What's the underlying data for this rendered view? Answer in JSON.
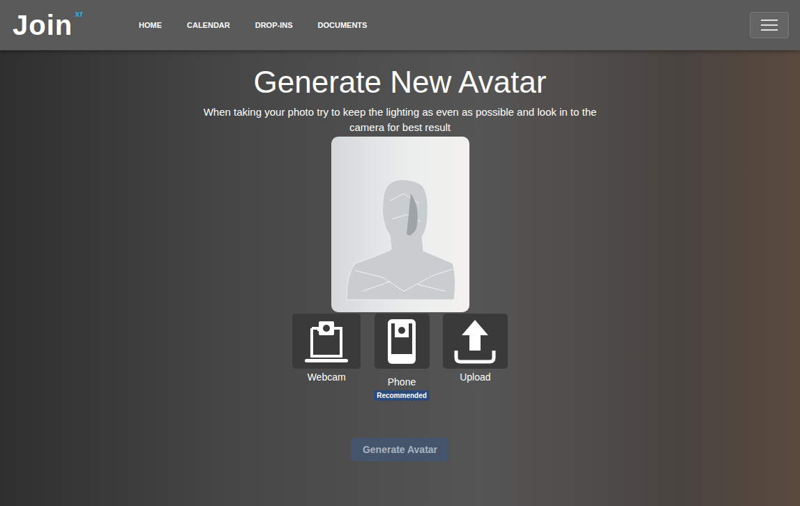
{
  "navbar": {
    "logo": {
      "text": "Join",
      "superscript": "xr"
    },
    "items": [
      {
        "label": "HOME",
        "selected": false
      },
      {
        "label": "CALENDAR",
        "selected": false
      },
      {
        "label": "DROP-INS",
        "selected": false
      },
      {
        "label": "DOCUMENTS",
        "selected": false
      }
    ]
  },
  "title": "Generate New Avatar",
  "subtitle": "When taking your photo try to keep the lighting as even as possible and look in to the camera for best result",
  "options": [
    {
      "label": "Webcam",
      "kind": "webcam",
      "recommended": false,
      "badge": ""
    },
    {
      "label": "Phone",
      "kind": "phone",
      "recommended": true,
      "badge": "Recommended"
    },
    {
      "label": "Upload",
      "kind": "upload",
      "recommended": false,
      "badge": ""
    }
  ],
  "generate_button": {
    "label": "Generate Avatar",
    "disabled": true
  }
}
